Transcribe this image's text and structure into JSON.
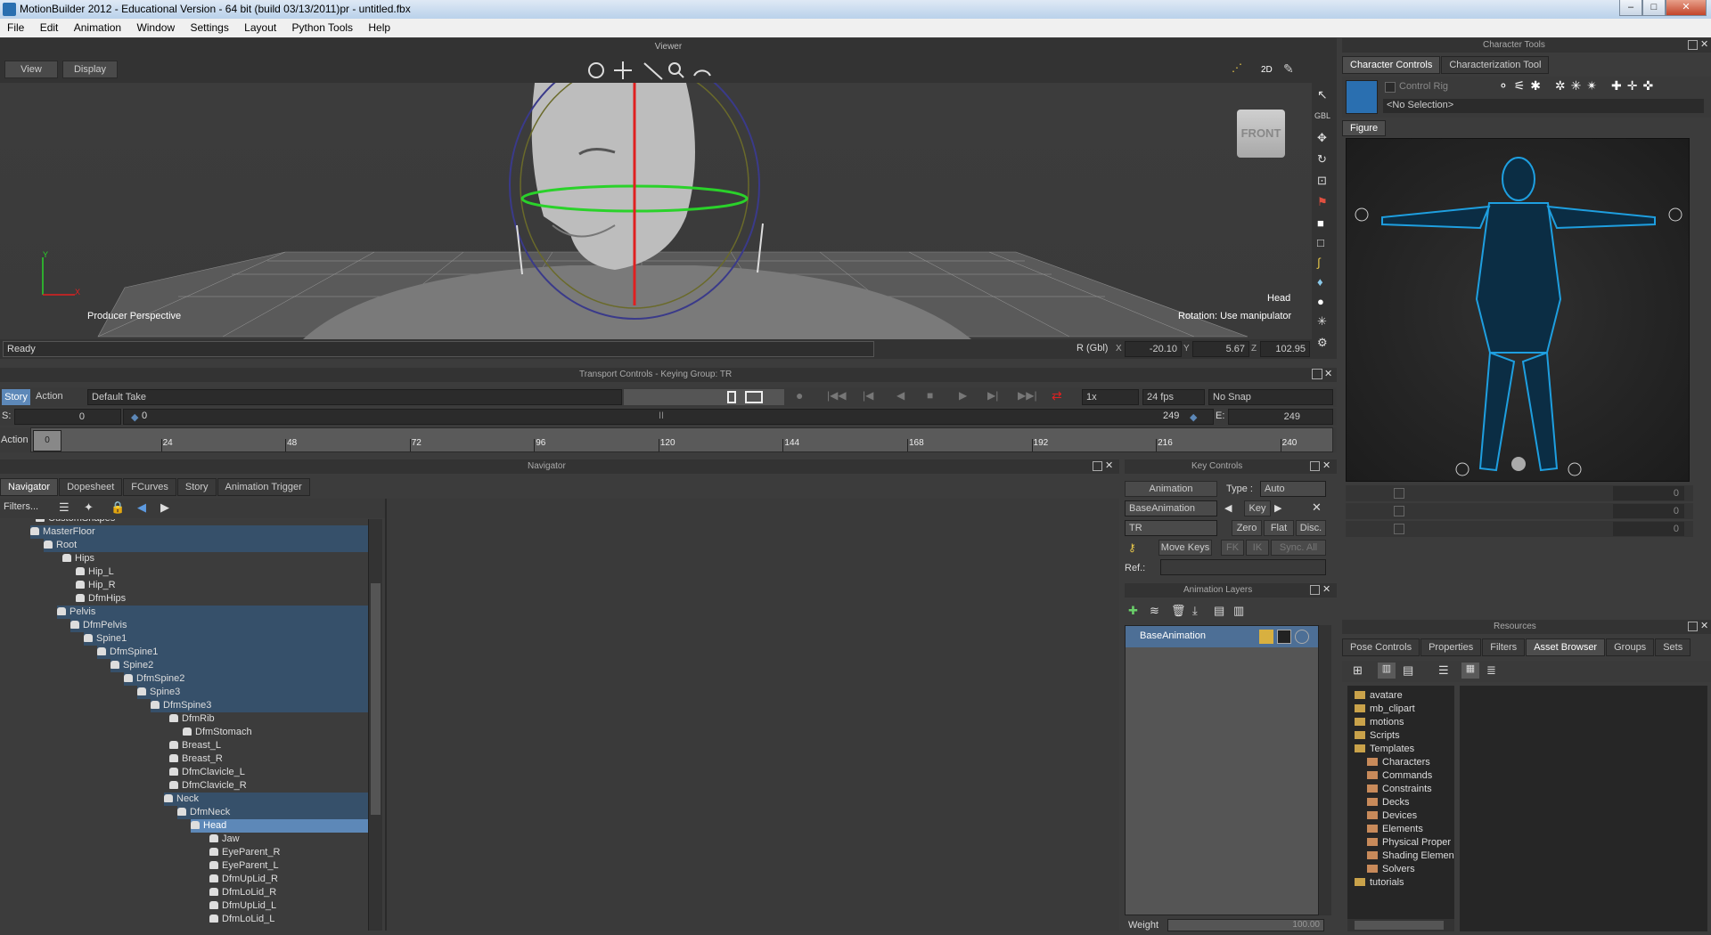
{
  "window": {
    "title": "MotionBuilder 2012 - Educational Version   - 64 bit (build 03/13/2011)pr  - untitled.fbx",
    "min": "–",
    "max": "□",
    "close": "✕"
  },
  "menu": [
    "File",
    "Edit",
    "Animation",
    "Window",
    "Settings",
    "Layout",
    "Python Tools",
    "Help"
  ],
  "viewer": {
    "header": "Viewer",
    "view_label": "View",
    "display_label": "Display",
    "cube_label": "FRONT",
    "camera_label": "Producer Perspective",
    "selection_label": "Head",
    "manip_label": "Rotation: Use manipulator",
    "axis_y": "Y",
    "axis_x": "X",
    "mode_2d": "2D",
    "gbl": "GBL",
    "status": "Ready",
    "coords": {
      "label": "R (Gbl)",
      "x_label": "X",
      "x": "-20.10",
      "y_label": "Y",
      "y": "5.67",
      "z_label": "Z",
      "z": "102.95"
    }
  },
  "transport": {
    "header": "Transport Controls  -  Keying Group: TR",
    "story_btn": "Story",
    "action_select": "Action",
    "take": "Default Take",
    "speed": "1x",
    "fps": "24 fps",
    "snap": "No Snap",
    "s_label": "S:",
    "s_value": "0",
    "start": "0",
    "end": "249",
    "e_label": "E:",
    "e_value": "249",
    "pause_mark": "II",
    "action_label": "Action",
    "ticks": [
      "24",
      "48",
      "72",
      "96",
      "120",
      "144",
      "168",
      "192",
      "216",
      "240"
    ],
    "ruler_max": 249,
    "current_frame": "0"
  },
  "navigator": {
    "header": "Navigator",
    "tabs": [
      "Navigator",
      "Dopesheet",
      "FCurves",
      "Story",
      "Animation Trigger"
    ],
    "filters": "Filters...",
    "tree": [
      {
        "label": "CustomShapes",
        "depth": 0,
        "hl": false
      },
      {
        "label": "MasterFloor",
        "depth": 0,
        "hl": true
      },
      {
        "label": "Root",
        "depth": 1,
        "hl": true
      },
      {
        "label": "Hips",
        "depth": 2,
        "hl": false
      },
      {
        "label": "Hip_L",
        "depth": 3,
        "hl": false
      },
      {
        "label": "Hip_R",
        "depth": 3,
        "hl": false
      },
      {
        "label": "DfmHips",
        "depth": 3,
        "hl": false
      },
      {
        "label": "Pelvis",
        "depth": 2,
        "hl": true
      },
      {
        "label": "DfmPelvis",
        "depth": 3,
        "hl": true
      },
      {
        "label": "Spine1",
        "depth": 4,
        "hl": true
      },
      {
        "label": "DfmSpine1",
        "depth": 5,
        "hl": true
      },
      {
        "label": "Spine2",
        "depth": 6,
        "hl": true
      },
      {
        "label": "DfmSpine2",
        "depth": 7,
        "hl": true
      },
      {
        "label": "Spine3",
        "depth": 8,
        "hl": true
      },
      {
        "label": "DfmSpine3",
        "depth": 9,
        "hl": true
      },
      {
        "label": "DfmRib",
        "depth": 10,
        "hl": false
      },
      {
        "label": "DfmStomach",
        "depth": 11,
        "hl": false
      },
      {
        "label": "Breast_L",
        "depth": 10,
        "hl": false
      },
      {
        "label": "Breast_R",
        "depth": 10,
        "hl": false
      },
      {
        "label": "DfmClavicle_L",
        "depth": 10,
        "hl": false
      },
      {
        "label": "DfmClavicle_R",
        "depth": 10,
        "hl": false
      },
      {
        "label": "Neck",
        "depth": 10,
        "hl": true
      },
      {
        "label": "DfmNeck",
        "depth": 11,
        "hl": true
      },
      {
        "label": "Head",
        "depth": 12,
        "hl": true,
        "sel": true
      },
      {
        "label": "Jaw",
        "depth": 13,
        "hl": false
      },
      {
        "label": "EyeParent_R",
        "depth": 13,
        "hl": false
      },
      {
        "label": "EyeParent_L",
        "depth": 13,
        "hl": false
      },
      {
        "label": "DfmUpLid_R",
        "depth": 13,
        "hl": false
      },
      {
        "label": "DfmLoLid_R",
        "depth": 13,
        "hl": false
      },
      {
        "label": "DfmUpLid_L",
        "depth": 13,
        "hl": false
      },
      {
        "label": "DfmLoLid_L",
        "depth": 13,
        "hl": false
      }
    ]
  },
  "key_controls": {
    "header": "Key Controls",
    "animation_btn": "Animation",
    "type_label": "Type :",
    "type_value": "Auto",
    "layer_select": "BaseAnimation",
    "key_btn": "Key",
    "group_select": "TR",
    "zero": "Zero",
    "flat": "Flat",
    "disc": "Disc.",
    "move_keys": "Move Keys",
    "fk": "FK",
    "ik": "IK",
    "sync_all": "Sync. All",
    "ref_label": "Ref.:"
  },
  "anim_layers": {
    "header": "Animation Layers",
    "layer": "BaseAnimation",
    "weight_label": "Weight",
    "weight_value": "100.00"
  },
  "char_tools": {
    "header": "Character Tools",
    "tabs": [
      "Character Controls",
      "Characterization Tool"
    ],
    "control_rig": "Control Rig",
    "selection": "<No Selection>",
    "figure_tab": "Figure",
    "rows": [
      "0",
      "0",
      "0"
    ]
  },
  "resources": {
    "header": "Resources",
    "tabs": [
      "Pose Controls",
      "Properties",
      "Filters",
      "Asset Browser",
      "Groups",
      "Sets"
    ],
    "tree": [
      {
        "label": "avatare",
        "depth": 0
      },
      {
        "label": "mb_clipart",
        "depth": 0
      },
      {
        "label": "motions",
        "depth": 0
      },
      {
        "label": "Scripts",
        "depth": 0
      },
      {
        "label": "Templates",
        "depth": 0
      },
      {
        "label": "Characters",
        "depth": 1
      },
      {
        "label": "Commands",
        "depth": 1
      },
      {
        "label": "Constraints",
        "depth": 1
      },
      {
        "label": "Decks",
        "depth": 1
      },
      {
        "label": "Devices",
        "depth": 1
      },
      {
        "label": "Elements",
        "depth": 1
      },
      {
        "label": "Physical Proper",
        "depth": 1
      },
      {
        "label": "Shading Elemen",
        "depth": 1
      },
      {
        "label": "Solvers",
        "depth": 1
      },
      {
        "label": "tutorials",
        "depth": 0
      }
    ]
  }
}
